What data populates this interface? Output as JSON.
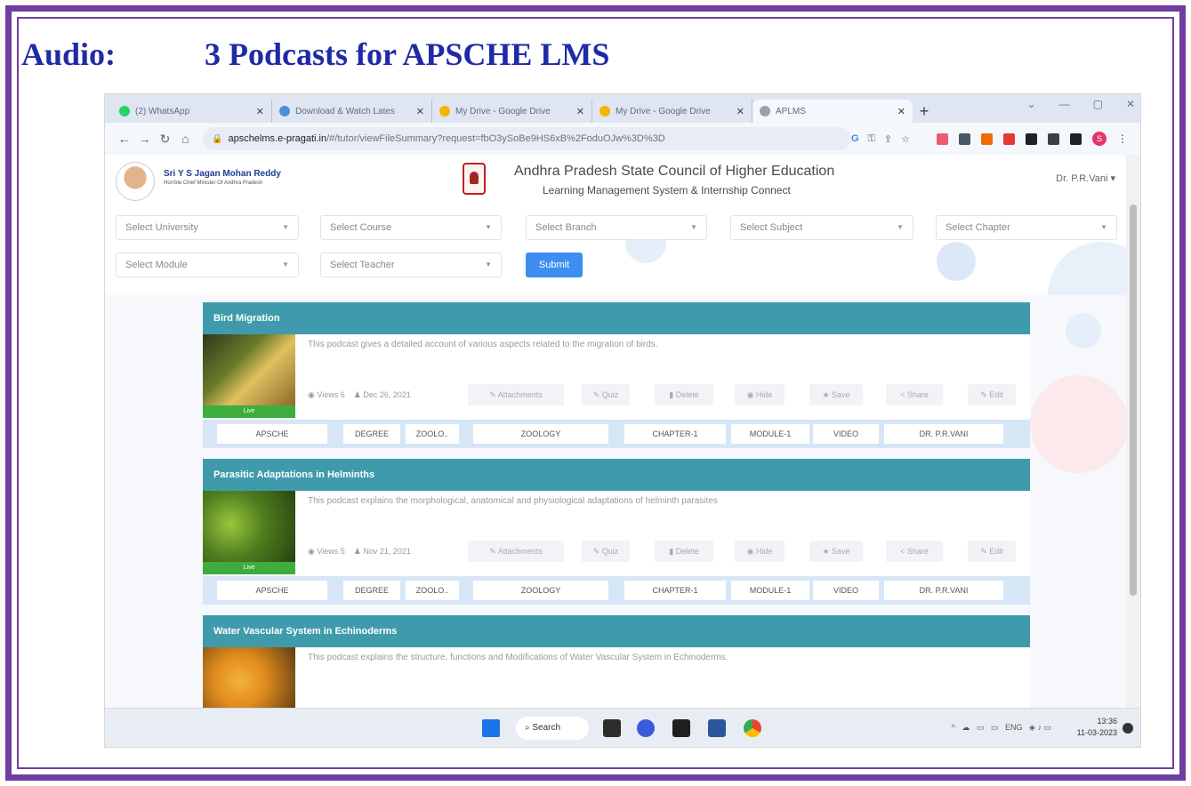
{
  "slide": {
    "label": "Audio:",
    "heading": "3 Podcasts for APSCHE LMS"
  },
  "browser": {
    "tabs": [
      {
        "label": "(2) WhatsApp",
        "color": "#25d366"
      },
      {
        "label": "Download & Watch Lates",
        "color": "#4a90d9"
      },
      {
        "label": "My Drive - Google Drive",
        "color": "#f4b400"
      },
      {
        "label": "My Drive - Google Drive",
        "color": "#f4b400"
      },
      {
        "label": "APLMS",
        "color": "#9aa0a6"
      }
    ],
    "url_domain": "apschelms.e-pragati.in",
    "url_path": "/#/tutor/viewFileSummary?request=fbO3ySoBe9HS6xB%2FoduOJw%3D%3D"
  },
  "header": {
    "cm_name": "Sri Y S Jagan Mohan Reddy",
    "cm_title": "Hon'ble Chief Minister Of Andhra Pradesh",
    "org_name": "Andhra Pradesh State Council of Higher Education",
    "org_sub": "Learning Management System & Internship Connect",
    "user": "Dr. P.R.Vani ▾"
  },
  "filters": {
    "university": "Select University",
    "course": "Select Course",
    "branch": "Select Branch",
    "subject": "Select Subject",
    "chapter": "Select Chapter",
    "module": "Select Module",
    "teacher": "Select Teacher",
    "submit": "Submit"
  },
  "actions": {
    "attachments": "Attachments",
    "quiz": "Quiz",
    "delete": "Delete",
    "hide": "Hide",
    "save": "Save",
    "share": "Share",
    "edit": "Edit"
  },
  "podcasts": [
    {
      "title": "Bird Migration",
      "description": "This podcast gives a detailed account of various aspects related to the migration of birds.",
      "views": "Views 6",
      "date": "Dec 26, 2021",
      "live": "Live",
      "tags": [
        "APSCHE",
        "DEGREE",
        "ZOOLO..",
        "ZOOLOGY",
        "CHAPTER-1",
        "MODULE-1",
        "VIDEO",
        "DR. P.R.VANI"
      ]
    },
    {
      "title": "Parasitic Adaptations in Helminths",
      "description": "This podcast explains the morphological, anatomical and physiological adaptations of helminth parasites",
      "views": "Views 5",
      "date": "Nov 21, 2021",
      "live": "Live",
      "tags": [
        "APSCHE",
        "DEGREE",
        "ZOOLO..",
        "ZOOLOGY",
        "CHAPTER-1",
        "MODULE-1",
        "VIDEO",
        "DR. P.R.VANI"
      ]
    },
    {
      "title": "Water Vascular System in Echinoderms",
      "description": "This podcast explains the structure, functions and Modifications of Water Vascular System in Echinoderms."
    }
  ],
  "taskbar": {
    "search": "Search",
    "tray": "ENG",
    "time": "13:36",
    "date": "11-03-2023"
  }
}
